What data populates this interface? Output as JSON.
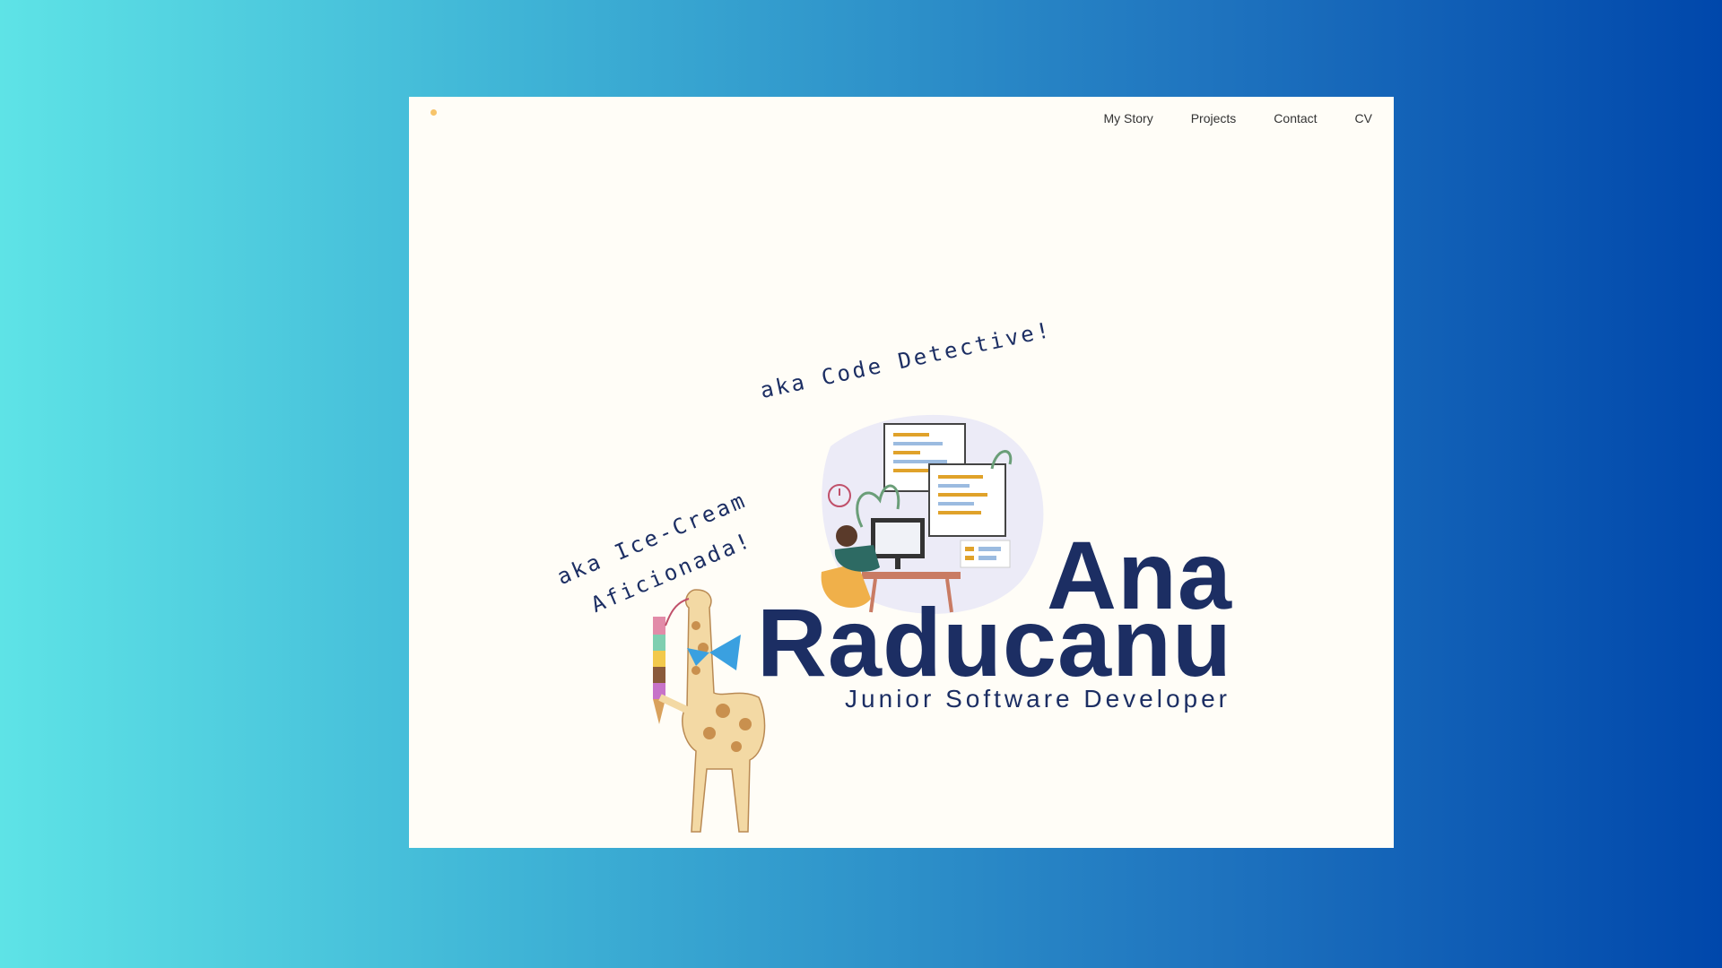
{
  "nav": {
    "items": [
      "My Story",
      "Projects",
      "Contact",
      "CV"
    ]
  },
  "hero": {
    "first_name": "Ana",
    "last_name": "Raducanu",
    "title": "Junior Software Developer",
    "aka_code": "aka Code Detective!",
    "aka_ice_line1": "aka Ice-Cream",
    "aka_ice_line2": "Aficionada!"
  },
  "colors": {
    "background_gradient_left": "#5ee3e6",
    "background_gradient_right": "#0047ab",
    "page_bg": "#fffdf7",
    "accent_navy": "#1c2e63",
    "logo_dot": "#f7c46a"
  },
  "icons": {
    "logo": "logo-dot-icon",
    "developer": "developer-at-desk-illustration",
    "giraffe": "giraffe-with-ice-cream-illustration"
  }
}
